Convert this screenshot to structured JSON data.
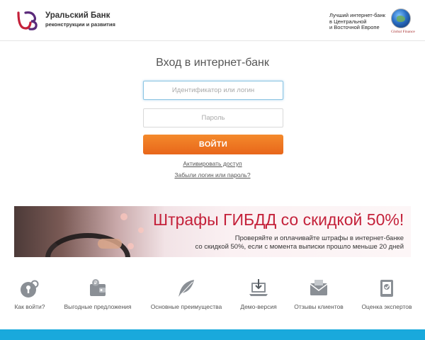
{
  "header": {
    "bank_name": "Уральский Банк",
    "bank_subtitle": "реконструкции и развития",
    "award_lines": [
      "Лучший интернет-банк",
      "в Центральной",
      "и Восточной Европе"
    ],
    "award_publisher": "Global Finance",
    "logo_icon": "ubrr-logo-icon",
    "globe_icon": "globe-award-icon"
  },
  "login": {
    "title": "Вход в интернет-банк",
    "login_placeholder": "Идентификатор или логин",
    "password_placeholder": "Пароль",
    "submit_label": "ВОЙТИ",
    "activate_link": "Активировать доступ",
    "forgot_link": "Забыли логин или пароль?"
  },
  "banner": {
    "title": "Штрафы ГИБДД со скидкой 50%!",
    "text_lines": [
      "Проверяйте и оплачивайте штрафы в интернет-банке",
      "со скидкой 50%, если с момента выписки прошло меньше 20 дней"
    ]
  },
  "features": [
    {
      "label": "Как войти?",
      "icon": "key-icon"
    },
    {
      "label": "Выгодные предложения",
      "icon": "wallet-icon"
    },
    {
      "label": "Основные преимущества",
      "icon": "feather-icon"
    },
    {
      "label": "Демо-версия",
      "icon": "laptop-download-icon"
    },
    {
      "label": "Отзывы клиентов",
      "icon": "envelope-icon"
    },
    {
      "label": "Оценка экспертов",
      "icon": "certificate-icon"
    }
  ],
  "colors": {
    "accent_orange": "#ee7422",
    "brand_red": "#c4213a",
    "brand_purple": "#5a2a7a",
    "bottom_bar": "#19a9dc",
    "icon_gray": "#8a8f95"
  }
}
